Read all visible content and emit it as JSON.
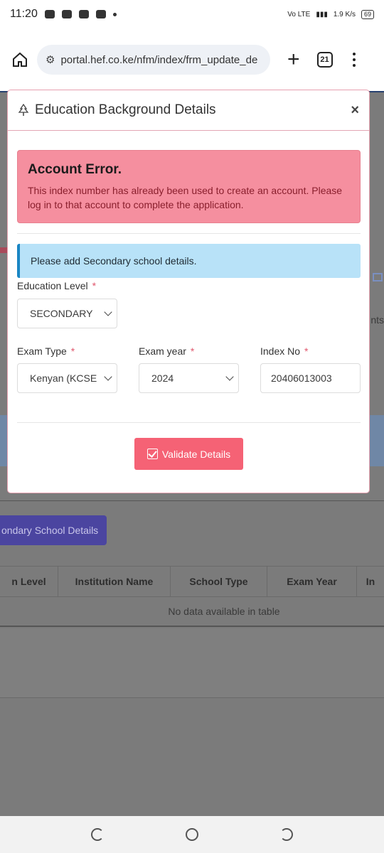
{
  "status_bar": {
    "time": "11:20",
    "network": "Vo LTE",
    "speed": "1.9 K/s",
    "battery": "69"
  },
  "browser": {
    "url": "portal.hef.co.ke/nfm/index/frm_update_de",
    "tab_count": "21"
  },
  "background": {
    "button_label": "ondary School Details",
    "table_headers": [
      "n Level",
      "Institution Name",
      "School Type",
      "Exam Year",
      "In"
    ],
    "empty_text": "No data available in table",
    "side_text_right": "nts"
  },
  "modal": {
    "title": "Education Background Details",
    "close": "×",
    "error_title": "Account Error.",
    "error_message": "This index number has already been used to create an account. Please log in to that account to complete the application.",
    "info_message": "Please add Secondary school details.",
    "education_level_label": "Education Level",
    "education_level_value": "SECONDARY",
    "exam_type_label": "Exam Type",
    "exam_type_value": "Kenyan (KCSE",
    "exam_year_label": "Exam year",
    "exam_year_value": "2024",
    "index_no_label": "Index No",
    "index_no_value": "20406013003",
    "required_mark": "*",
    "validate_label": "Validate Details"
  },
  "colors": {
    "error_bg": "#f58f9f",
    "info_bg": "#b8e2f8",
    "accent": "#f56275"
  }
}
